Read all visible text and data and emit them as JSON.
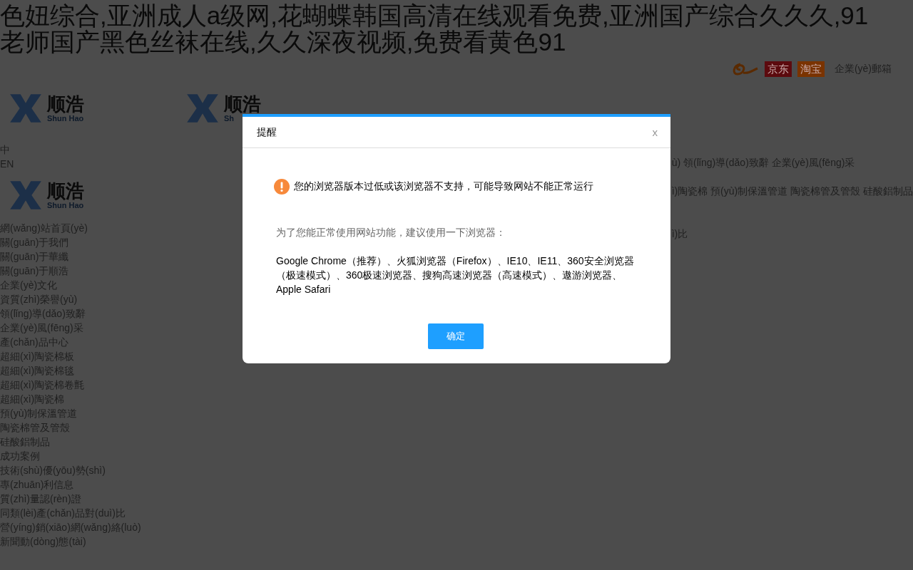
{
  "page_title": "色妞综合,亚洲成人a级网,花蝴蝶韩国高清在线观看免费,亚洲国产综合久久久,91老师国产黑色丝袜在线,久久深夜视频,免费看黄色91",
  "top_links": [
    {
      "kind": "alibaba"
    },
    {
      "kind": "badge",
      "label": "京东",
      "color": "#5c0a0e"
    },
    {
      "kind": "badge",
      "label": "淘宝",
      "color": "#7a3300"
    },
    {
      "kind": "text",
      "label": "企業(yè)郵箱"
    }
  ],
  "logos": [
    {
      "name": "顺浩",
      "sub": "Shun Hao"
    },
    {
      "name": "顺浩",
      "sub": "Sh"
    }
  ],
  "languages": [
    "中",
    "EN"
  ],
  "logo_bottom": {
    "name": "顺浩",
    "sub": "Shun Hao"
  },
  "nav": [
    "網(wǎng)站首頁(yè)",
    "關(guān)于我們",
    "關(guān)于華纖",
    "關(guān)于順浩",
    "企業(yè)文化",
    "資質(zhì)榮譽(yù)",
    "領(lǐng)導(dǎo)致辭",
    "企業(yè)風(fēng)采",
    "產(chǎn)品中心",
    "超細(xì)陶瓷棉板",
    "超細(xì)陶瓷棉毯",
    "超細(xì)陶瓷棉卷氈",
    "超細(xì)陶瓷棉",
    "預(yù)制保溫管道",
    "陶瓷棉管及管殼",
    "硅酸鋁制品",
    "成功案例",
    "技術(shù)優(yōu)勢(shì)",
    "專(zhuān)利信息",
    "質(zhì)量認(rèn)證",
    "同類(lèi)產(chǎn)品對(duì)比",
    "營(yíng)銷(xiāo)網(wǎng)絡(luò)",
    "新聞動(dòng)態(tài)"
  ],
  "behind_fragments": [
    "ù) 領(lǐng)導(dǎo)致辭 企業(yè)風(fēng)采",
    "ì)陶瓷棉 預(yù)制保溫管道 陶瓷棉管及管殼 硅酸鋁制品",
    "ì)比"
  ],
  "dialog": {
    "title": "提醒",
    "close": "x",
    "warning": "您的浏览器版本过低或该浏览器不支持，可能导致网站不能正常运行",
    "advice": "为了您能正常使用网站功能，建议使用一下浏览器：",
    "browsers": "Google Chrome（推荐）、火狐浏览器（Firefox）、IE10、IE11、360安全浏览器（极速模式）、360极速浏览器、搜狗高速浏览器（高速模式）、遨游浏览器、Apple Safari",
    "button": "确定"
  }
}
